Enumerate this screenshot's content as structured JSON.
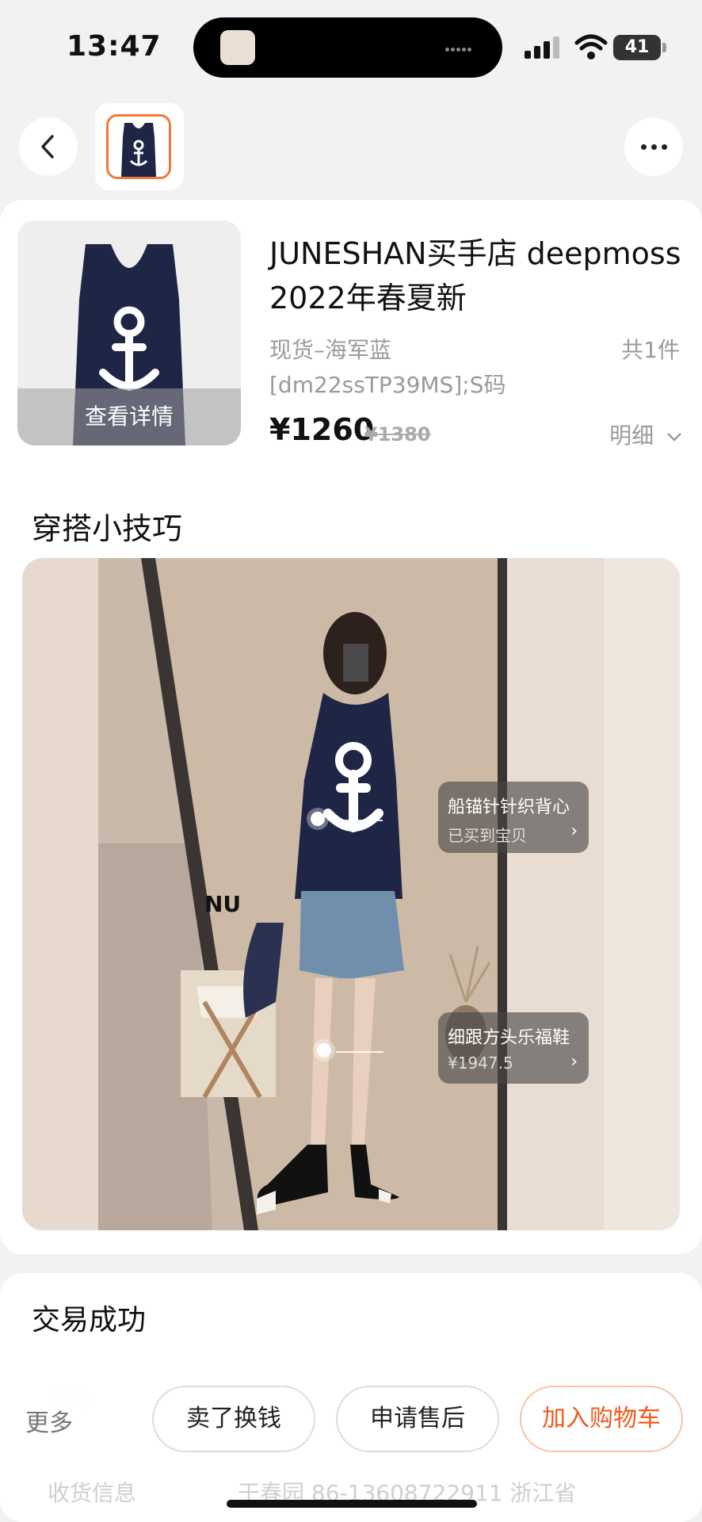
{
  "status_bar": {
    "time": "13:47",
    "battery": "41"
  },
  "product": {
    "shop_title": "JUNESHAN买手店 deepmoss 2022年春夏新",
    "sku": "现货–海军蓝 [dm22ssTP39MS];S码",
    "quantity": "共1件",
    "price": "¥1260",
    "original_price": "¥1380",
    "detail_label": "明细",
    "view_detail_label": "查看详情"
  },
  "outfit": {
    "section_title": "穿搭小技巧",
    "tags": [
      {
        "name": "船锚针针织背心",
        "sub": "已买到宝贝"
      },
      {
        "name": "细跟方头乐福鞋",
        "sub": "¥1947.5"
      }
    ],
    "chair_logo": "NU"
  },
  "order_status": {
    "title": "交易成功",
    "underlay_row1": "单号",
    "underlay_row2_label": "收货信息",
    "underlay_row2_value": "干春园 86-13608722911 浙江省"
  },
  "actions": {
    "more": "更多",
    "sell": "卖了换钱",
    "after_sale": "申请售后",
    "add_cart": "加入购物车"
  },
  "colors": {
    "accent": "#f05a1a",
    "navy": "#1f2545",
    "background": "#f2f2f2"
  }
}
